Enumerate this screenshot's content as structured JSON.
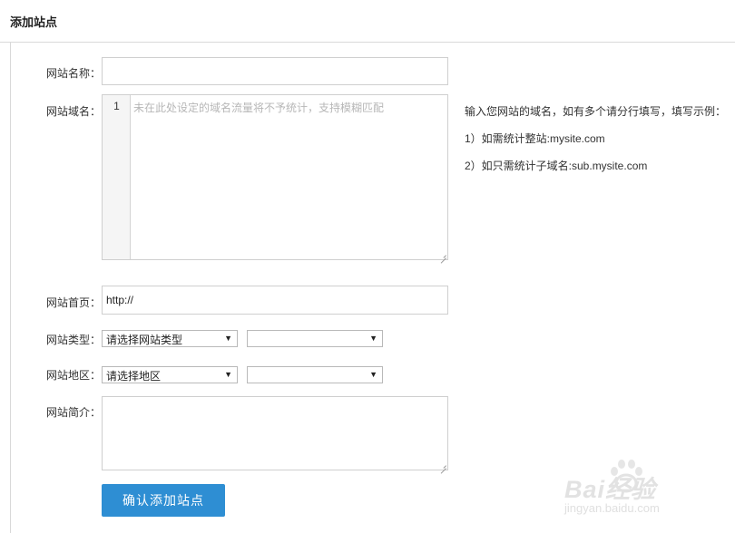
{
  "page": {
    "title": "添加站点"
  },
  "form": {
    "name_label": "网站名称：",
    "name_value": "",
    "domain_label": "网站域名：",
    "domain_line_number": "1",
    "domain_placeholder": "未在此处设定的域名流量将不予统计，支持模糊匹配",
    "homepage_label": "网站首页：",
    "homepage_value": "http://",
    "type_label": "网站类型：",
    "type_select": "请选择网站类型",
    "type_subselect": "",
    "region_label": "网站地区：",
    "region_select": "请选择地区",
    "region_subselect": "",
    "intro_label": "网站简介：",
    "intro_value": "",
    "submit_label": "确认添加站点"
  },
  "help": {
    "line1": "输入您网站的域名，如有多个请分行填写，填写示例：",
    "line2": "1）如需统计整站:mysite.com",
    "line3": "2）如只需统计子域名:sub.mysite.com"
  },
  "watermark": {
    "brand": "Bai经验",
    "url": "jingyan.baidu.com"
  },
  "icons": {
    "dropdown": "chevron-down-icon",
    "resize": "resize-grip-icon"
  },
  "colors": {
    "button": "#2e8ed3",
    "placeholder": "#b7b7b7",
    "border": "#cfcfcf"
  }
}
